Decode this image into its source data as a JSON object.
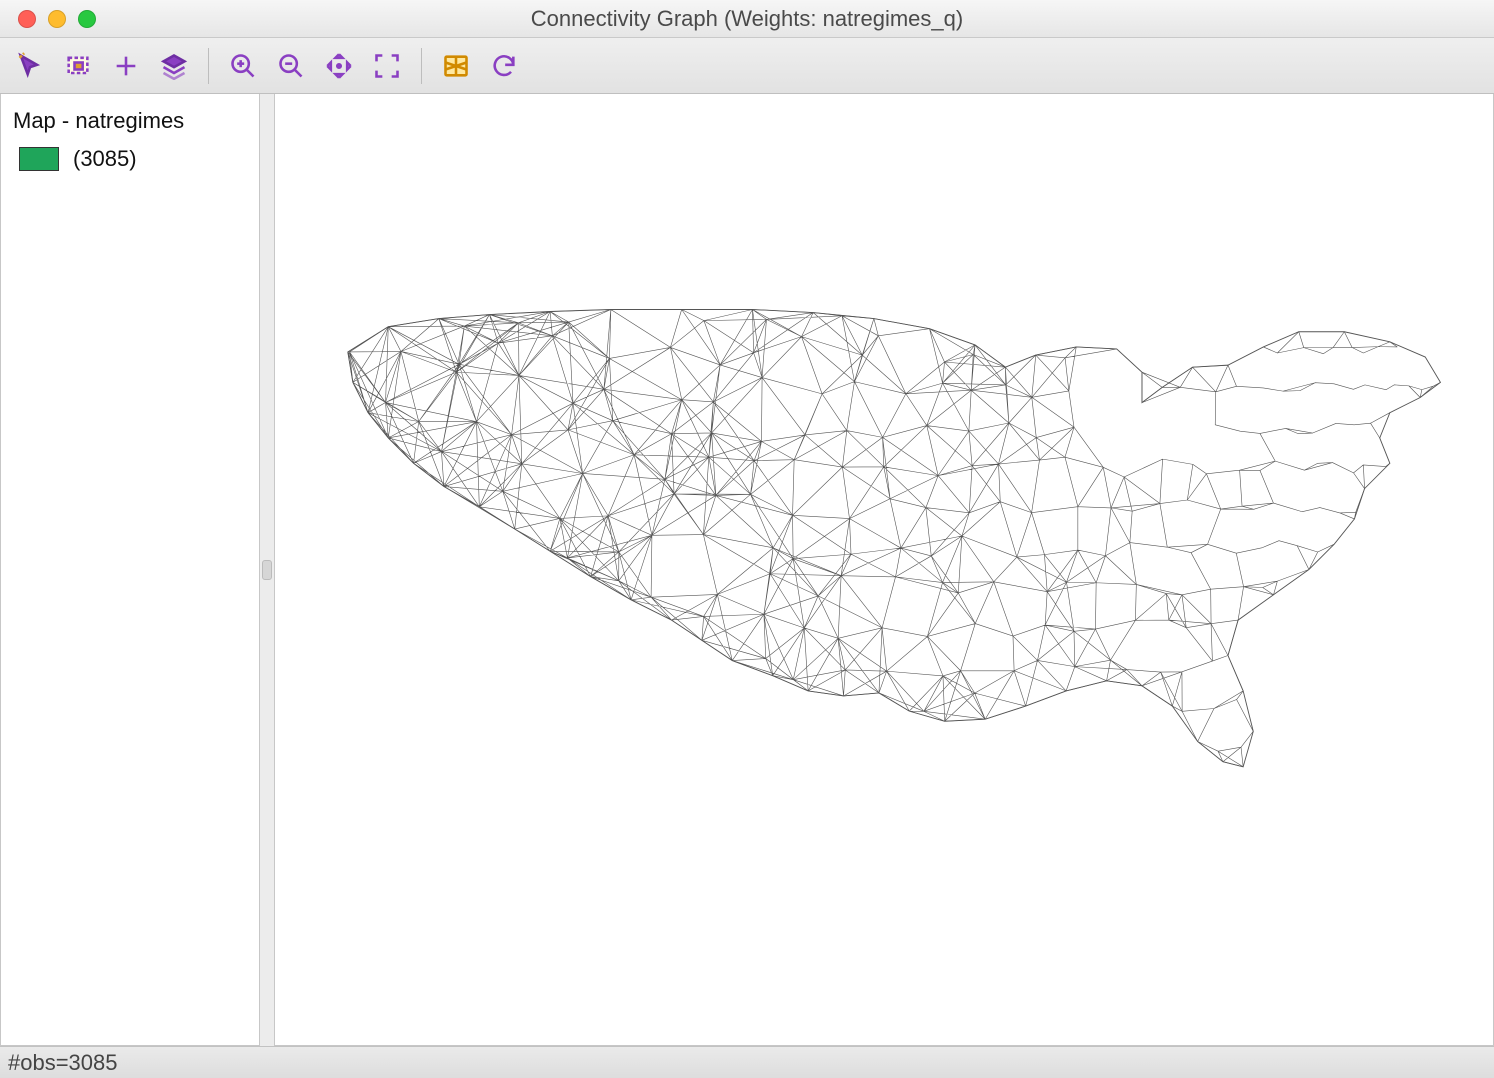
{
  "window": {
    "title": "Connectivity Graph (Weights: natregimes_q)"
  },
  "toolbar": {
    "icons": {
      "select": "select-arrow-icon",
      "selectrect": "select-rect-icon",
      "add": "plus-icon",
      "layers": "layers-icon",
      "zoomin": "zoom-in-icon",
      "zoomout": "zoom-out-icon",
      "pan": "pan-icon",
      "extent": "fit-extent-icon",
      "basemap": "basemap-icon",
      "refresh": "refresh-icon"
    }
  },
  "legend": {
    "title": "Map - natregimes",
    "items": [
      {
        "color": "#1fa55a",
        "label": "(3085)"
      }
    ]
  },
  "status": {
    "text": "#obs=3085"
  }
}
